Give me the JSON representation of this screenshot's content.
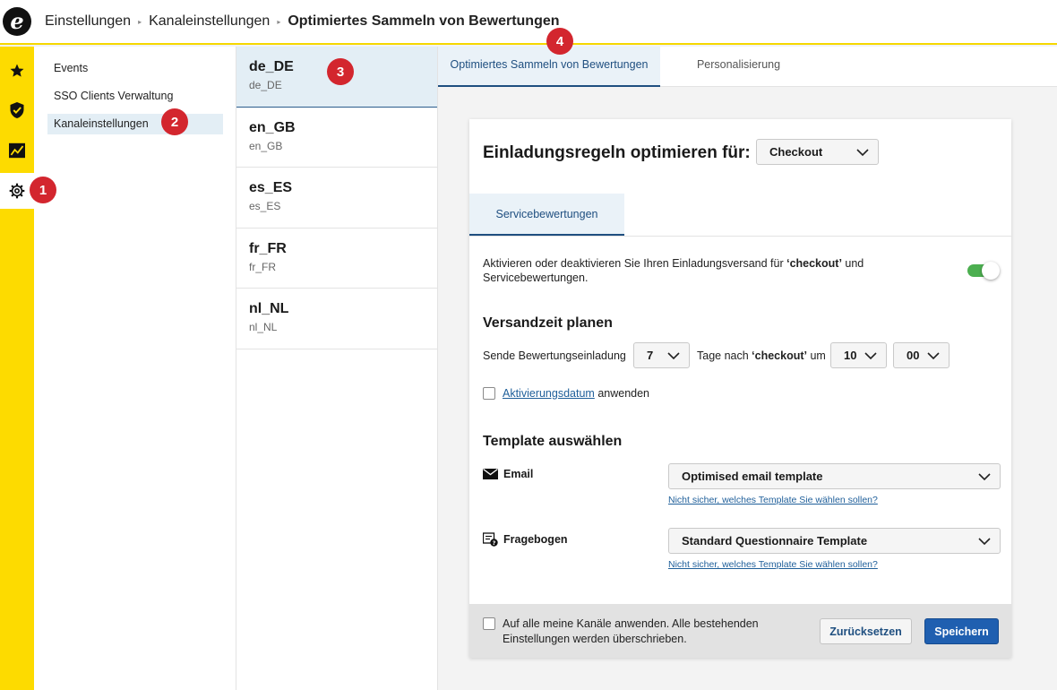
{
  "header": {
    "logo_letter": "e",
    "breadcrumb": [
      "Einstellungen",
      "Kanaleinstellungen",
      "Optimiertes Sammeln von Bewertungen"
    ],
    "separator": "▸"
  },
  "rail": {
    "items": [
      {
        "icon": "star-icon"
      },
      {
        "icon": "shield-check-icon"
      },
      {
        "icon": "analytics-icon"
      },
      {
        "icon": "gear-icon",
        "active": true
      }
    ]
  },
  "sidebar": {
    "items": [
      {
        "label": "Events"
      },
      {
        "label": "SSO Clients Verwaltung"
      },
      {
        "label": "Kanaleinstellungen",
        "active": true
      }
    ]
  },
  "locales": [
    {
      "code": "de_DE",
      "sub": "de_DE",
      "active": true
    },
    {
      "code": "en_GB",
      "sub": "en_GB"
    },
    {
      "code": "es_ES",
      "sub": "es_ES"
    },
    {
      "code": "fr_FR",
      "sub": "fr_FR"
    },
    {
      "code": "nl_NL",
      "sub": "nl_NL"
    }
  ],
  "tabs": [
    {
      "label": "Optimiertes Sammeln von Bewertungen",
      "active": true
    },
    {
      "label": "Personalisierung"
    }
  ],
  "card": {
    "title": "Einladungsregeln optimieren für:",
    "optimize_for": "Checkout",
    "subtab": "Servicebewertungen",
    "description_prefix": "Aktivieren oder deaktivieren Sie Ihren Einladungsversand für ",
    "description_bold": "‘checkout’",
    "description_suffix": " und Servicebewertungen.",
    "toggle_on": true,
    "schedule": {
      "heading": "Versandzeit planen",
      "send_label": "Sende Bewertungseinladung",
      "days_value": "7",
      "days_after_prefix": "Tage nach ",
      "days_after_bold": "‘checkout’",
      "days_after_suffix": " um",
      "hour_value": "10",
      "minute_value": "00",
      "activation_link": "Aktivierungsdatum",
      "activation_suffix": "anwenden",
      "activation_checked": false
    },
    "template": {
      "heading": "Template auswählen",
      "email_label": "Email",
      "email_value": "Optimised email template",
      "email_help": "Nicht sicher, welches Template Sie wählen sollen?",
      "questionnaire_label": "Fragebogen",
      "questionnaire_value": "Standard Questionnaire Template",
      "questionnaire_help": "Nicht sicher, welches Template Sie wählen sollen?"
    },
    "footer": {
      "apply_all": "Auf alle meine Kanäle anwenden. Alle bestehenden Einstellungen werden überschrieben.",
      "apply_all_checked": false,
      "reset_label": "Zurücksetzen",
      "save_label": "Speichern"
    }
  },
  "badges": [
    "1",
    "2",
    "3",
    "4"
  ],
  "colors": {
    "brand_yellow": "#fddb00",
    "accent_blue": "#1f5fb0",
    "badge_red": "#d3262e",
    "toggle_green": "#4caf50",
    "selected_bg": "#e3eef5"
  }
}
